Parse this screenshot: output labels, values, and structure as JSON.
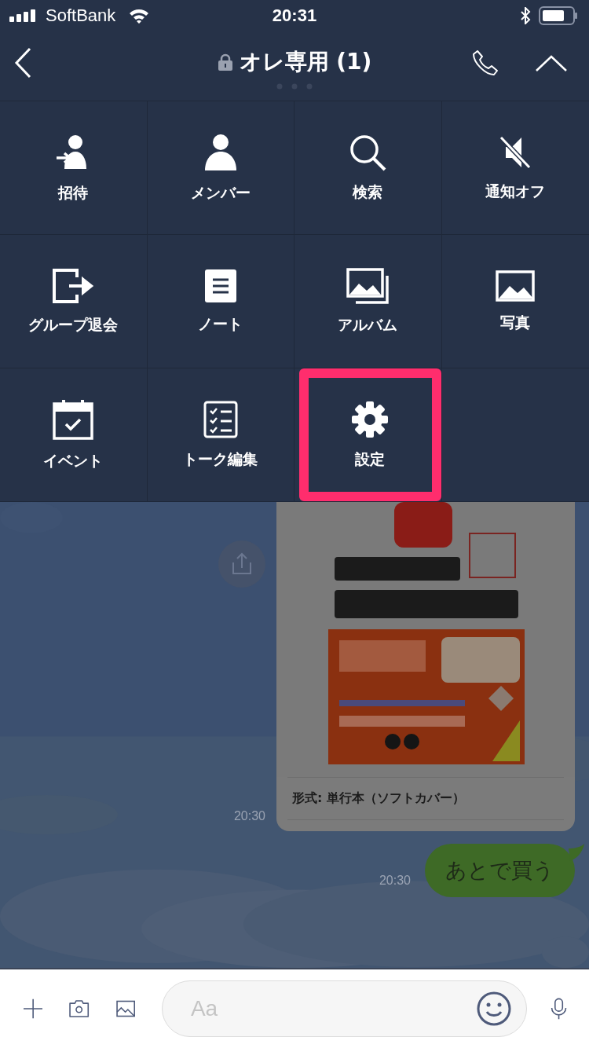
{
  "status_bar": {
    "carrier": "SoftBank",
    "time": "20:31"
  },
  "header": {
    "title": "オレ専用 (1)"
  },
  "menu": [
    {
      "label": "招待",
      "kind": "invite",
      "highlighted": false
    },
    {
      "label": "メンバー",
      "kind": "members",
      "highlighted": false
    },
    {
      "label": "検索",
      "kind": "search",
      "highlighted": false
    },
    {
      "label": "通知オフ",
      "kind": "mute",
      "highlighted": false
    },
    {
      "label": "グループ退会",
      "kind": "leave",
      "highlighted": false
    },
    {
      "label": "ノート",
      "kind": "note",
      "highlighted": false
    },
    {
      "label": "アルバム",
      "kind": "album",
      "highlighted": false
    },
    {
      "label": "写真",
      "highlighted": false
    },
    {
      "label": "イベント",
      "kind": "event",
      "highlighted": false
    },
    {
      "label": "トーク編集",
      "kind": "edit",
      "highlighted": false
    },
    {
      "label": "設定",
      "kind": "settings",
      "highlighted": true
    }
  ],
  "messages": [
    {
      "kind": "card",
      "format": "形式: 単行本（ソフトカバー）",
      "time": "20:30"
    },
    {
      "kind": "text",
      "text": "あとで買う",
      "time": "20:30"
    }
  ],
  "input": {
    "placeholder": "Aa"
  }
}
